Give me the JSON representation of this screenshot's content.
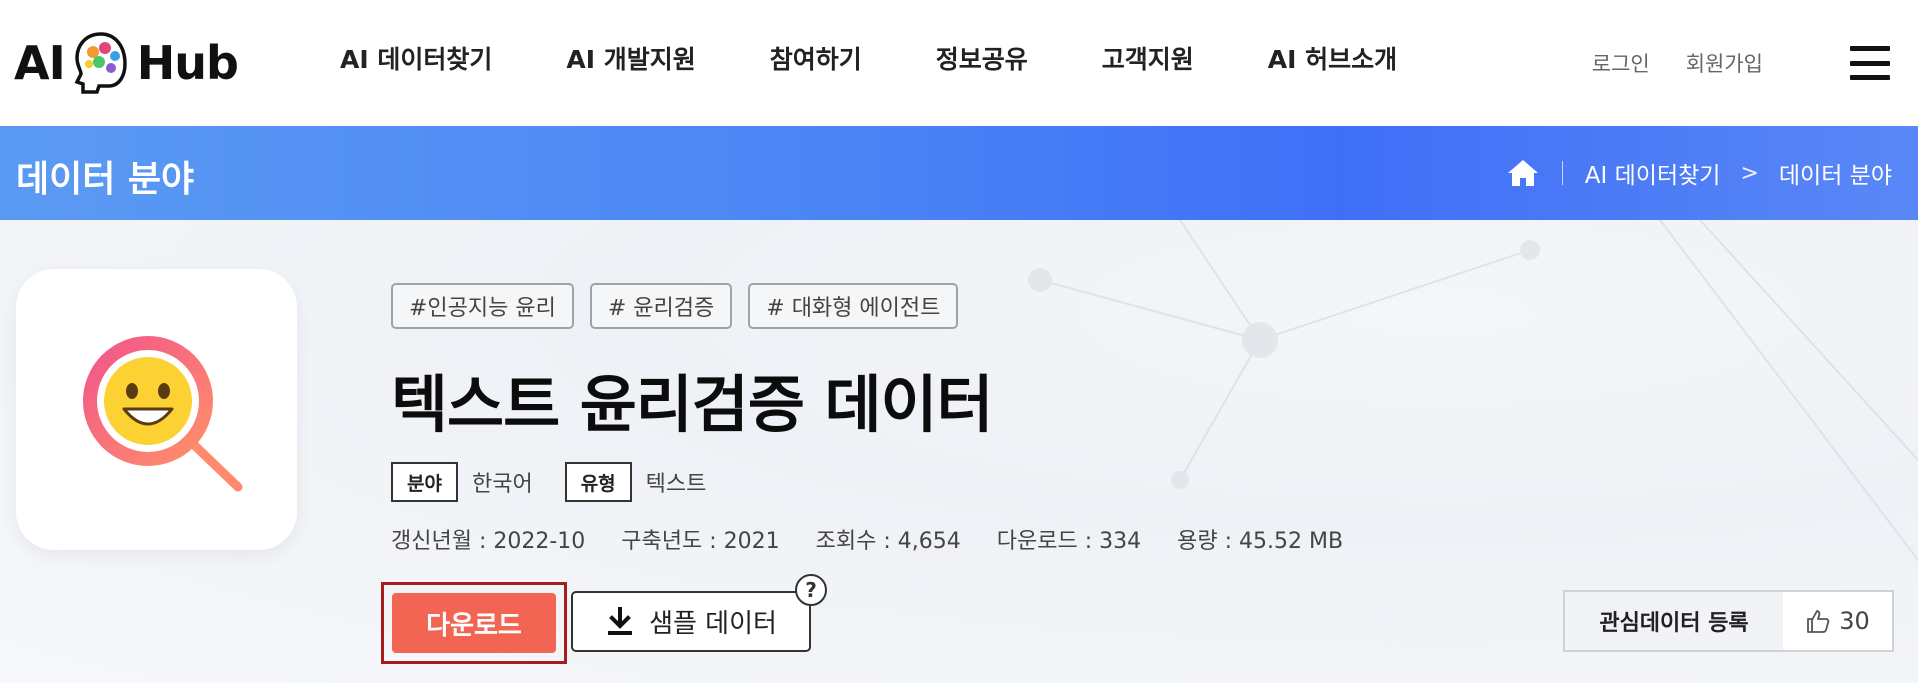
{
  "header": {
    "logo": {
      "left": "AI",
      "right": "Hub"
    },
    "nav": [
      "AI 데이터찾기",
      "AI 개발지원",
      "참여하기",
      "정보공유",
      "고객지원",
      "AI 허브소개"
    ],
    "login": "로그인",
    "signup": "회원가입",
    "menu_icon": "hamburger-menu-icon"
  },
  "banner": {
    "title": "데이터 분야",
    "breadcrumb": {
      "home_icon": "home-icon",
      "item1": "AI 데이터찾기",
      "separator": ">",
      "item2": "데이터 분야"
    }
  },
  "dataset": {
    "icon": "smile-magnifier-icon",
    "tags": [
      "#인공지능 윤리",
      "# 윤리검증",
      "# 대화형 에이전트"
    ],
    "title": "텍스트 윤리검증 데이터",
    "field_label": "분야",
    "field_value": "한국어",
    "type_label": "유형",
    "type_value": "텍스트",
    "stats": [
      "갱신년월 : 2022-10",
      "구축년도 : 2021",
      "조회수 : 4,654",
      "다운로드 : 334",
      "용량 : 45.52 MB"
    ]
  },
  "actions": {
    "download": "다운로드",
    "sample": "샘플 데이터",
    "help": "?",
    "interest": "관심데이터 등록",
    "like_count": "30"
  },
  "colors": {
    "banner_start": "#5b9af3",
    "banner_end": "#3f6ff7",
    "download": "#f26552",
    "download_outline": "#a81c1c"
  }
}
